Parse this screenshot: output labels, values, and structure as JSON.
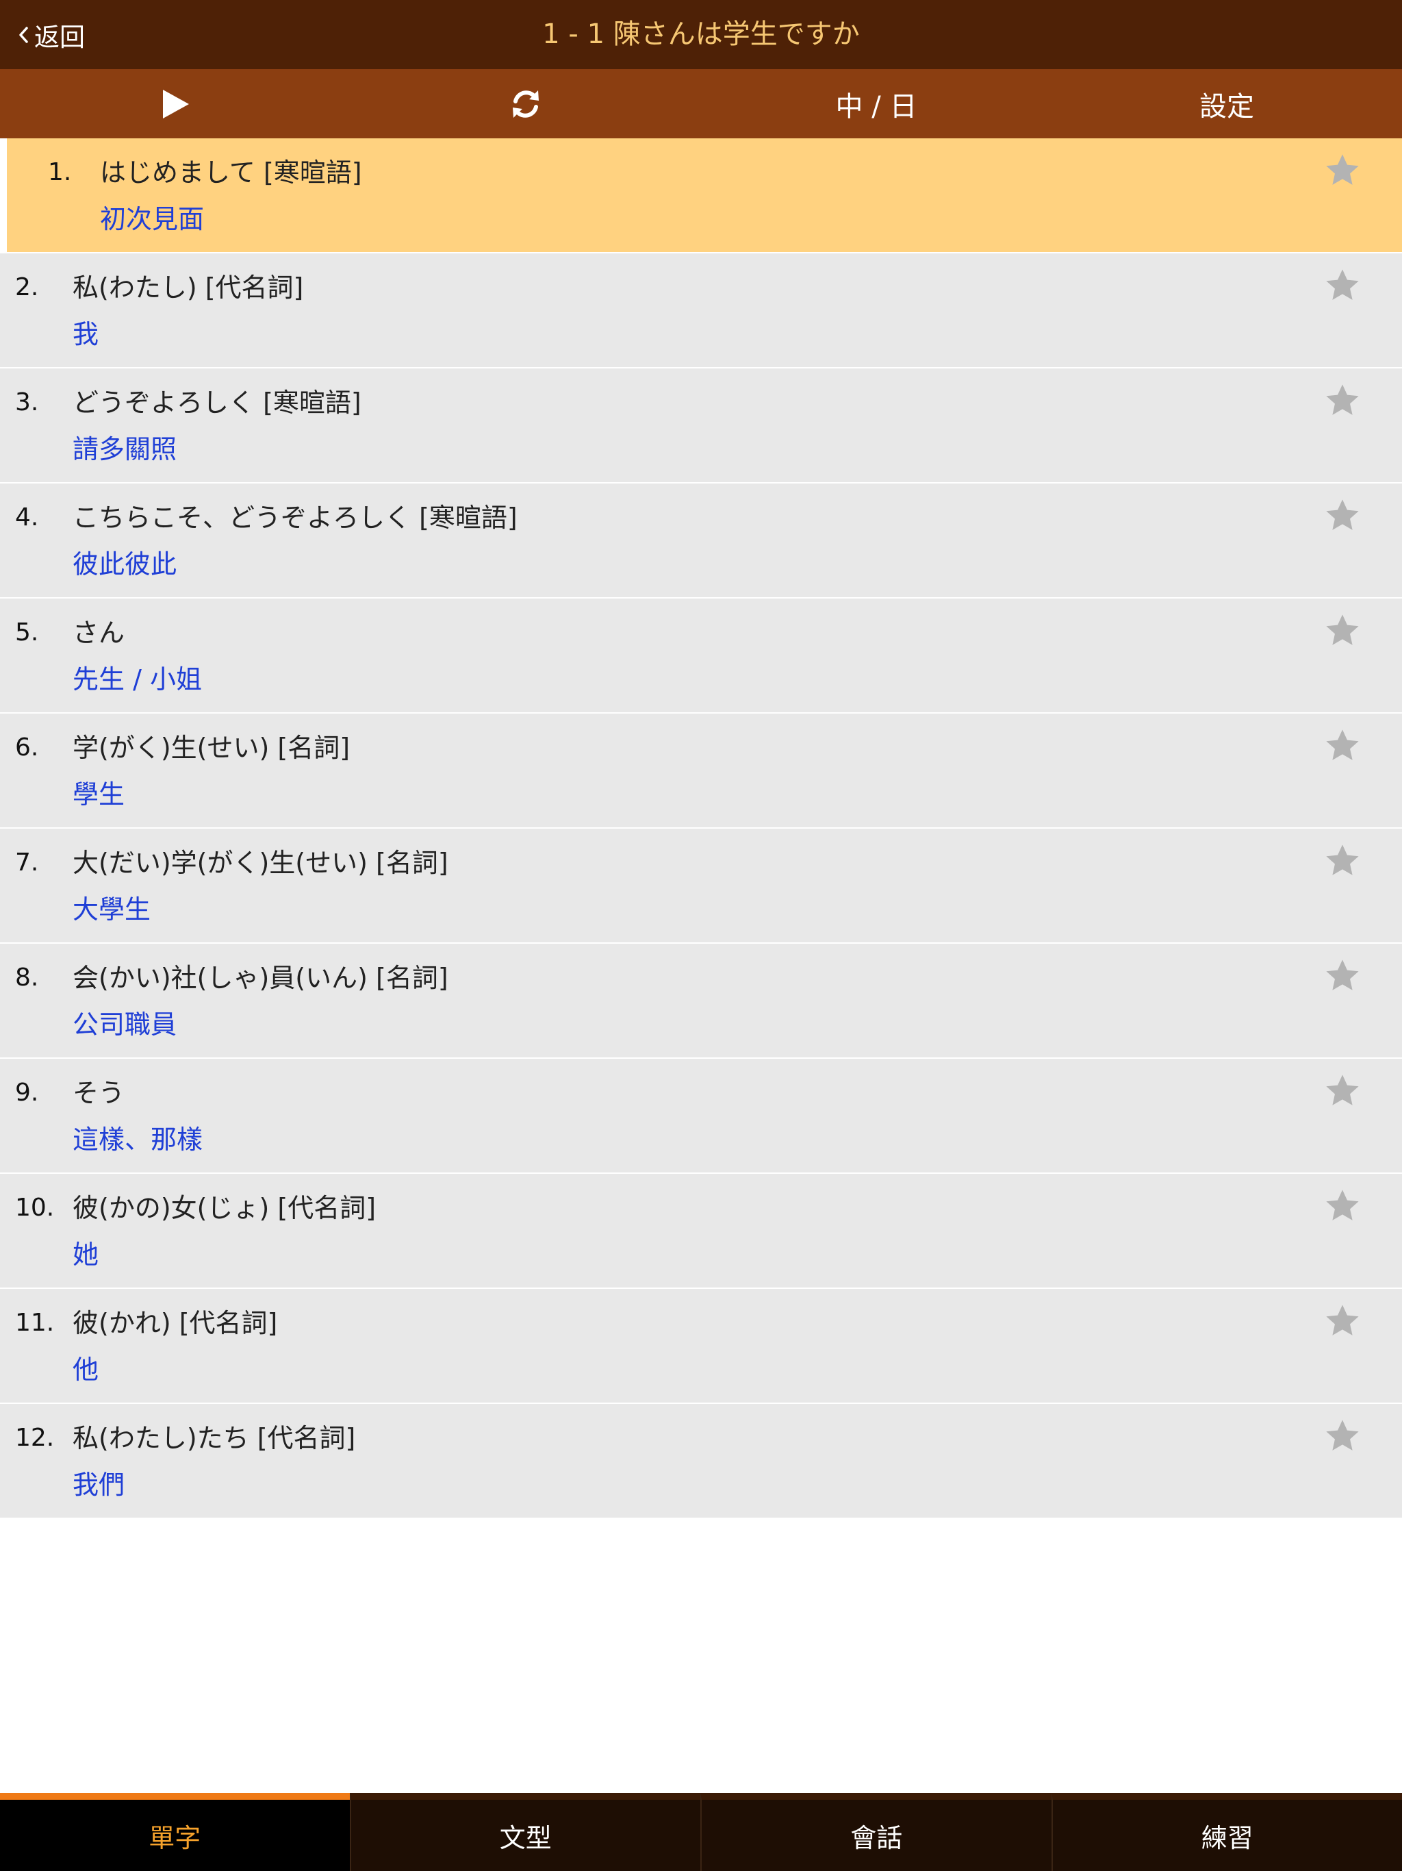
{
  "nav": {
    "back_label": "返回",
    "title": "1 - 1 陳さんは学生ですか"
  },
  "toolbar": {
    "play_icon": "play-icon",
    "refresh_icon": "refresh-icon",
    "lang_label": "中 / 日",
    "settings_label": "設定"
  },
  "colors": {
    "navbar": "#4e2106",
    "toolbar": "#8b3e11",
    "title": "#f6c773",
    "selected_row": "#ffd280",
    "row": "#e8e8e8",
    "meaning": "#1f3fd6",
    "star": "#b3b3b3",
    "tab_active_text": "#f7a32c",
    "tab_active_indicator": "#ef7a16"
  },
  "words": [
    {
      "num": "1.",
      "jp": "はじめまして  [寒暄語]",
      "zh": "初次見面",
      "selected": true
    },
    {
      "num": "2.",
      "jp": "私(わたし)  [代名詞]",
      "zh": "我"
    },
    {
      "num": "3.",
      "jp": "どうぞよろしく  [寒暄語]",
      "zh": "請多關照"
    },
    {
      "num": "4.",
      "jp": "こちらこそ、どうぞよろしく  [寒暄語]",
      "zh": "彼此彼此"
    },
    {
      "num": "5.",
      "jp": "さん",
      "zh": "先生 / 小姐"
    },
    {
      "num": "6.",
      "jp": "学(がく)生(せい)  [名詞]",
      "zh": "學生"
    },
    {
      "num": "7.",
      "jp": "大(だい)学(がく)生(せい)  [名詞]",
      "zh": "大學生"
    },
    {
      "num": "8.",
      "jp": "会(かい)社(しゃ)員(いん)  [名詞]",
      "zh": "公司職員"
    },
    {
      "num": "9.",
      "jp": "そう",
      "zh": "這樣、那樣"
    },
    {
      "num": "10.",
      "jp": "彼(かの)女(じょ)  [代名詞]",
      "zh": "她"
    },
    {
      "num": "11.",
      "jp": "彼(かれ)  [代名詞]",
      "zh": "他"
    },
    {
      "num": "12.",
      "jp": "私(わたし)たち  [代名詞]",
      "zh": "我們"
    }
  ],
  "tabs": [
    {
      "label": "單字",
      "active": true
    },
    {
      "label": "文型"
    },
    {
      "label": "會話"
    },
    {
      "label": "練習"
    }
  ]
}
